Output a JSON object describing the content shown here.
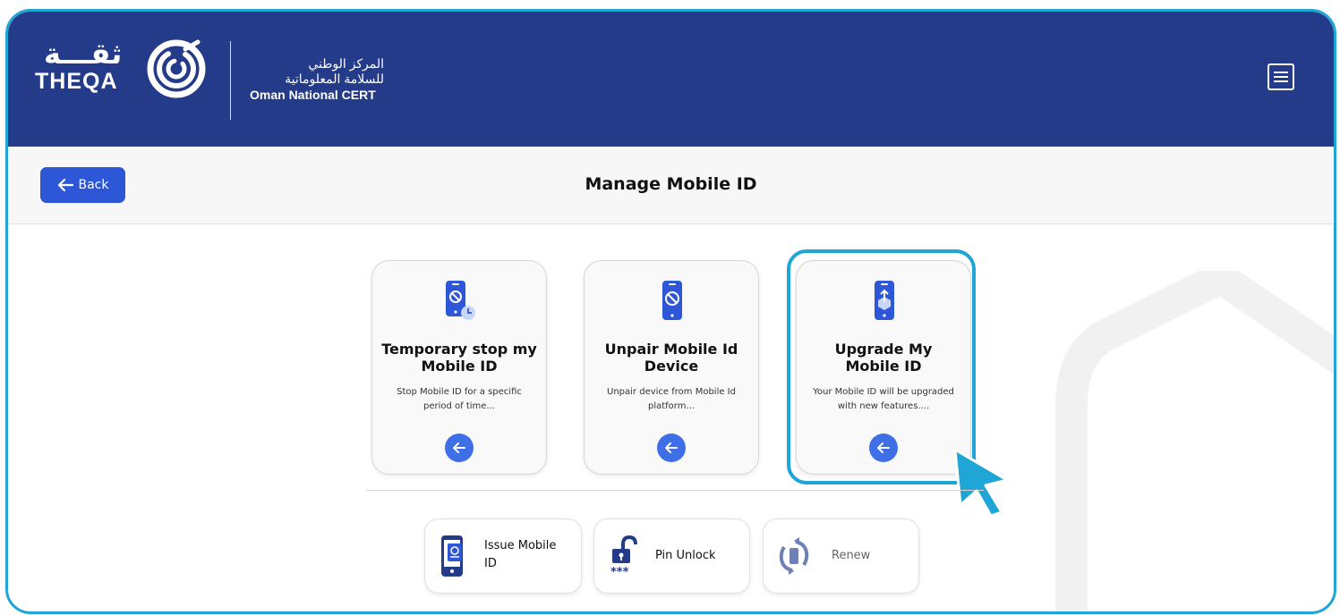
{
  "header": {
    "logo_arabic": "ثقـــة",
    "logo_latin": "THEQA",
    "org_name_ar_line1": "المركز الوطني",
    "org_name_ar_line2": "للسلامة المعلوماتية",
    "org_name_en": "Oman National CERT",
    "menu_icon": "hamburger-menu-icon"
  },
  "subbar": {
    "back_label": "Back",
    "page_title": "Manage Mobile ID"
  },
  "options": [
    {
      "title": "Temporary stop my Mobile ID",
      "description": "Stop Mobile ID for a specific period of time...",
      "icon": "phone-blocked-clock-icon"
    },
    {
      "title": "Unpair Mobile Id Device",
      "description": "Unpair device from Mobile Id platform...",
      "icon": "phone-blocked-icon"
    },
    {
      "title": "Upgrade My Mobile ID",
      "description": "Your Mobile ID will be upgraded with new features....",
      "icon": "phone-upgrade-icon",
      "highlighted": true
    }
  ],
  "actions": [
    {
      "label": "Issue Mobile ID",
      "icon": "phone-id-icon"
    },
    {
      "label": "Pin Unlock",
      "icon": "unlock-pin-icon"
    },
    {
      "label": "Renew",
      "icon": "renew-phone-icon",
      "disabled": true
    }
  ],
  "colors": {
    "header_bg": "#233b88",
    "accent": "#2d57d6",
    "highlight": "#1fa5d6"
  }
}
